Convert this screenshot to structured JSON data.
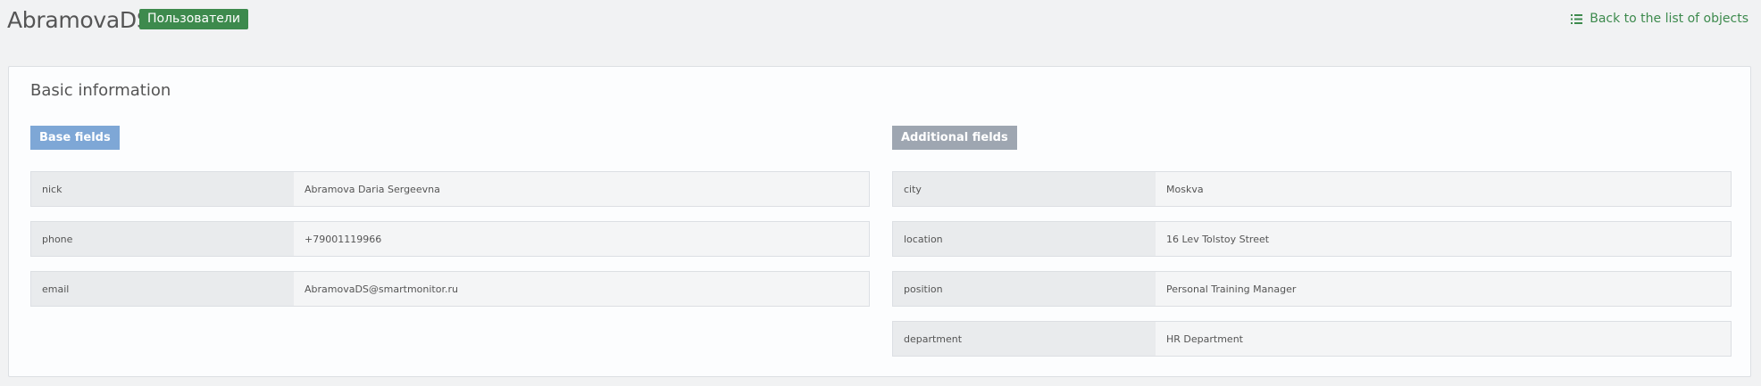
{
  "header": {
    "title": "AbramovaDS",
    "badge": "Пользователи",
    "back_link": "Back to the list of objects",
    "back_icon": "list-icon",
    "accent_color": "#3d8a4d"
  },
  "card": {
    "title": "Basic information",
    "base_section": {
      "label": "Base fields",
      "color": "#7ea7d6",
      "fields": [
        {
          "label": "nick",
          "value": "Abramova Daria Sergeevna"
        },
        {
          "label": "phone",
          "value": "+79001119966"
        },
        {
          "label": "email",
          "value": "AbramovaDS@smartmonitor.ru"
        }
      ]
    },
    "additional_section": {
      "label": "Additional fields",
      "color": "#9ea6b1",
      "fields": [
        {
          "label": "city",
          "value": "Moskva"
        },
        {
          "label": "location",
          "value": "16 Lev Tolstoy Street"
        },
        {
          "label": "position",
          "value": "Personal Training Manager"
        },
        {
          "label": "department",
          "value": "HR Department"
        }
      ]
    }
  }
}
